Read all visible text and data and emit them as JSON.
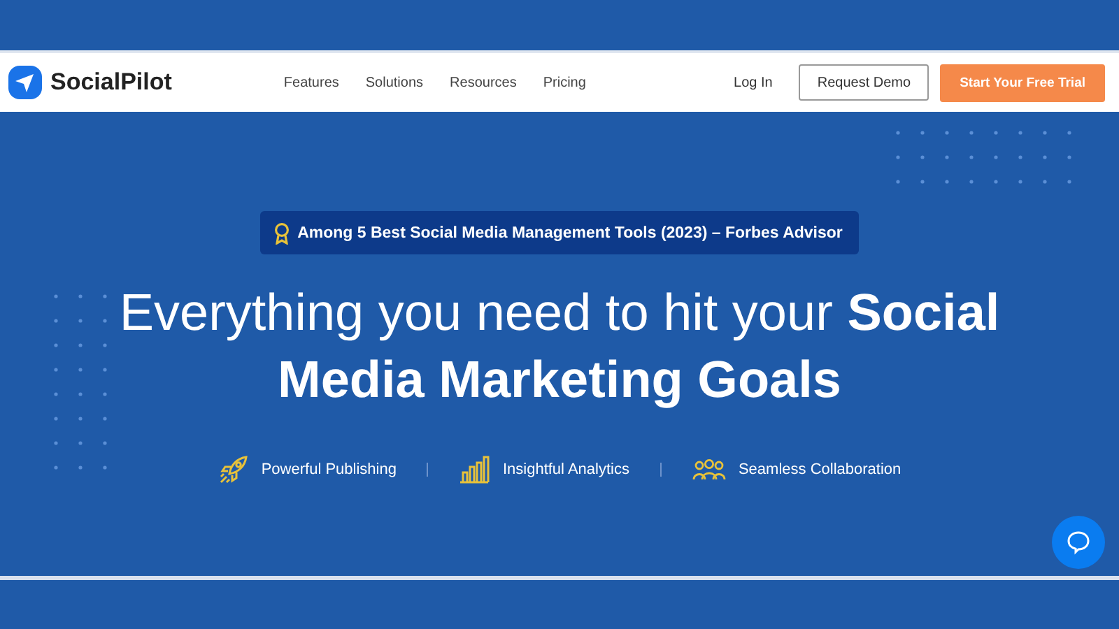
{
  "nav": {
    "brand": "SocialPilot",
    "links": [
      "Features",
      "Solutions",
      "Resources",
      "Pricing"
    ],
    "login": "Log In",
    "demo": "Request Demo",
    "trial": "Start Your Free Trial"
  },
  "hero": {
    "award": "Among 5 Best Social Media Management Tools (2023) – Forbes Advisor",
    "headline": "Everything you need to hit your **Social Media Marketing Goals**",
    "features": [
      "Powerful Publishing",
      "Insightful Analytics",
      "Seamless Collaboration"
    ]
  }
}
